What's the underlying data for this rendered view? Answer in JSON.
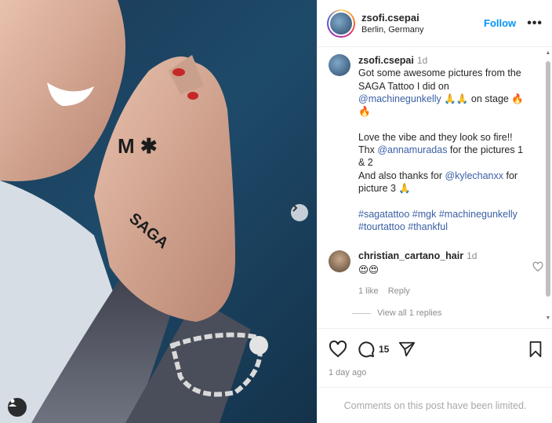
{
  "photo": {
    "description_icon": "carousel-next-icon",
    "tag_icon": "user-tag-icon",
    "tattoo_text": "SAGA"
  },
  "header": {
    "username": "zsofi.csepai",
    "location": "Berlin, Germany",
    "follow_label": "Follow",
    "more_label": "•••"
  },
  "caption": {
    "username": "zsofi.csepai",
    "time": "1d",
    "line1": "Got some awesome pictures from the SAGA Tattoo I did on ",
    "mention1": "@machinegunkelly",
    "line1_end": " 🙏🙏 on stage 🔥🔥",
    "para2_a": "Love the vibe and they look so fire!!",
    "para2_b": "Thx ",
    "mention2": "@annamuradas",
    "para2_c": " for the pictures 1 & 2",
    "para2_d": "And also thanks for ",
    "mention3": "@kylechanxx",
    "para2_e": " for picture 3 🙏",
    "hashtags": "#sagatattoo #mgk #machinegunkelly #tourtattoo #thankful"
  },
  "comment": {
    "username": "christian_cartano_hair",
    "time": "1d",
    "text": "😍😍",
    "likes": "1 like",
    "reply_label": "Reply",
    "view_replies": "View all 1 replies"
  },
  "actions": {
    "comment_count": "15",
    "date": "1 day ago"
  },
  "footer": {
    "limited_text": "Comments on this post have been limited."
  }
}
